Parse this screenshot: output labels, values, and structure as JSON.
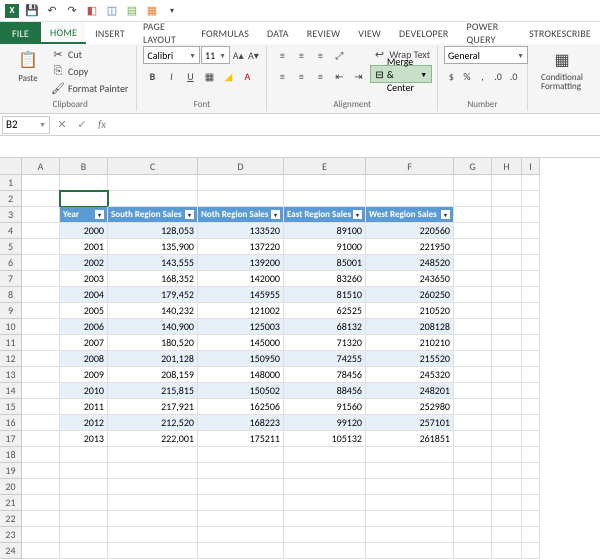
{
  "qat": {
    "save": "💾",
    "undo": "↶",
    "redo": "↷"
  },
  "tabs": {
    "file": "FILE",
    "home": "HOME",
    "insert": "INSERT",
    "pagelayout": "PAGE LAYOUT",
    "formulas": "FORMULAS",
    "data": "DATA",
    "review": "REVIEW",
    "view": "VIEW",
    "developer": "DEVELOPER",
    "powerquery": "POWER QUERY",
    "strokescribe": "StrokeScribe"
  },
  "ribbon": {
    "clipboard": {
      "paste": "Paste",
      "cut": "Cut",
      "copy": "Copy",
      "format_painter": "Format Painter",
      "label": "Clipboard"
    },
    "font": {
      "name": "Calibri",
      "size": "11",
      "label": "Font"
    },
    "alignment": {
      "wrap": "Wrap Text",
      "merge": "Merge & Center",
      "label": "Alignment"
    },
    "number": {
      "format": "General",
      "label": "Number"
    },
    "conditional": "Conditional\nFormatting"
  },
  "namebox": "B2",
  "columns": [
    "A",
    "B",
    "C",
    "D",
    "E",
    "F",
    "G",
    "H",
    "I"
  ],
  "table": {
    "headers": [
      "Year",
      "South Region Sales",
      "Noth Region Sales",
      "East Region Sales",
      "West Region Sales"
    ],
    "rows": [
      [
        "2000",
        "128,053",
        "133520",
        "89100",
        "220560"
      ],
      [
        "2001",
        "135,900",
        "137220",
        "91000",
        "221950"
      ],
      [
        "2002",
        "143,555",
        "139200",
        "85001",
        "248520"
      ],
      [
        "2003",
        "168,352",
        "142000",
        "83260",
        "243650"
      ],
      [
        "2004",
        "179,452",
        "145955",
        "81510",
        "260250"
      ],
      [
        "2005",
        "140,232",
        "121002",
        "62525",
        "210520"
      ],
      [
        "2006",
        "140,900",
        "125003",
        "68132",
        "208128"
      ],
      [
        "2007",
        "180,520",
        "145000",
        "71320",
        "210210"
      ],
      [
        "2008",
        "201,128",
        "150950",
        "74255",
        "215520"
      ],
      [
        "2009",
        "208,159",
        "148000",
        "78456",
        "245320"
      ],
      [
        "2010",
        "215,815",
        "150502",
        "88456",
        "248201"
      ],
      [
        "2011",
        "217,921",
        "162506",
        "91560",
        "252980"
      ],
      [
        "2012",
        "212,520",
        "168223",
        "99120",
        "257101"
      ],
      [
        "2013",
        "222,001",
        "175211",
        "105132",
        "261851"
      ]
    ]
  }
}
